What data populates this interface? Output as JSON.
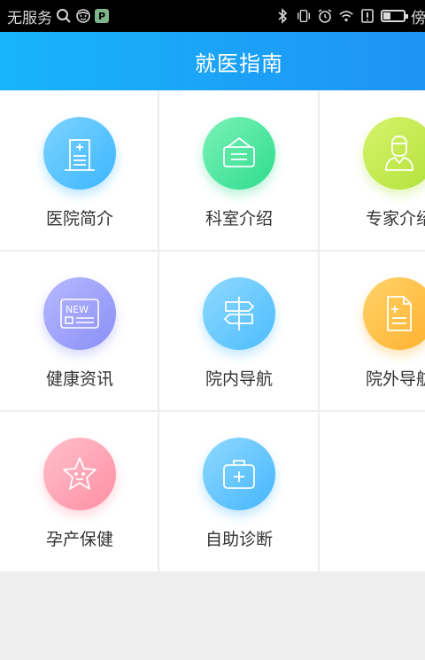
{
  "status_bar": {
    "carrier": "无服务",
    "app_badge": "P",
    "suffix_text": "傍晚",
    "icons": [
      "search-icon",
      "face-icon",
      "app-badge-icon",
      "bluetooth-icon",
      "vibrate-icon",
      "alarm-icon",
      "wifi-icon",
      "alert-icon",
      "battery-icon"
    ],
    "battery_level": 0.35
  },
  "header": {
    "title": "就医指南"
  },
  "grid": {
    "items": [
      {
        "label": "医院简介",
        "icon": "hospital-building-icon",
        "color_from": "#7ed3ff",
        "color_to": "#3bb6ff"
      },
      {
        "label": "科室介绍",
        "icon": "department-sign-icon",
        "color_from": "#7cf2b8",
        "color_to": "#2edc8e"
      },
      {
        "label": "专家介绍",
        "icon": "doctor-icon",
        "color_from": "#d6f36c",
        "color_to": "#b2e23a"
      },
      {
        "label": "健康资讯",
        "icon": "news-icon",
        "color_from": "#b7b9ff",
        "color_to": "#8a8ff6"
      },
      {
        "label": "院内导航",
        "icon": "signpost-icon",
        "color_from": "#8fd9ff",
        "color_to": "#4cbcfd"
      },
      {
        "label": "院外导航",
        "icon": "document-icon",
        "color_from": "#ffd36a",
        "color_to": "#ffb12e"
      },
      {
        "label": "孕产保健",
        "icon": "star-baby-icon",
        "color_from": "#ffc0cb",
        "color_to": "#ff8ea3"
      },
      {
        "label": "自助诊断",
        "icon": "medical-kit-icon",
        "color_from": "#8fd9ff",
        "color_to": "#45b6fd"
      }
    ]
  }
}
